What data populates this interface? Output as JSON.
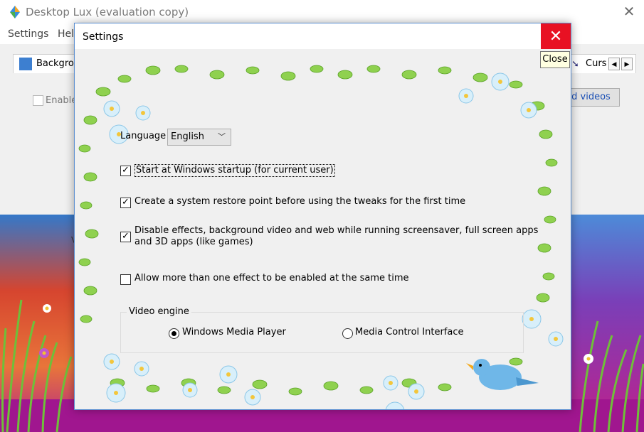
{
  "app": {
    "title": "Desktop Lux (evaluation copy)",
    "close_glyph": "✕"
  },
  "menu": {
    "items": [
      "Settings",
      "Hel"
    ]
  },
  "main": {
    "tab_left_label": "Backgrou",
    "tab_right_label": "Curs",
    "tab_right_icon": "cursor-icon",
    "scroll_left": "◀",
    "scroll_right": "▶",
    "enable_label": "Enable",
    "videos_button": "d videos",
    "left_fragment": "V"
  },
  "dialog": {
    "title": "Settings",
    "close_glyph": "✕",
    "close_tooltip": "Close",
    "language_label": "Language",
    "language_value": "English",
    "language_chevron": "﹀",
    "options": [
      {
        "label": "Start at Windows startup (for current user)",
        "checked": true
      },
      {
        "label": "Create a system restore point before using the tweaks for the first time",
        "checked": true
      },
      {
        "label": "Disable effects, background video and web while running screensaver, full screen apps",
        "label2": "and 3D apps (like games)",
        "checked": true
      },
      {
        "label": "Allow more than one effect to be enabled at the same time",
        "checked": false
      }
    ],
    "video_engine": {
      "legend": "Video engine",
      "choices": [
        {
          "label": "Windows Media Player",
          "selected": true
        },
        {
          "label": "Media Control Interface",
          "selected": false
        }
      ]
    },
    "tick_glyph": "✓"
  },
  "colors": {
    "accent_close": "#e81123",
    "border_accent": "#5a8ed1",
    "leaf_green": "#7cc242",
    "flower_blue": "#bfe3f5"
  }
}
